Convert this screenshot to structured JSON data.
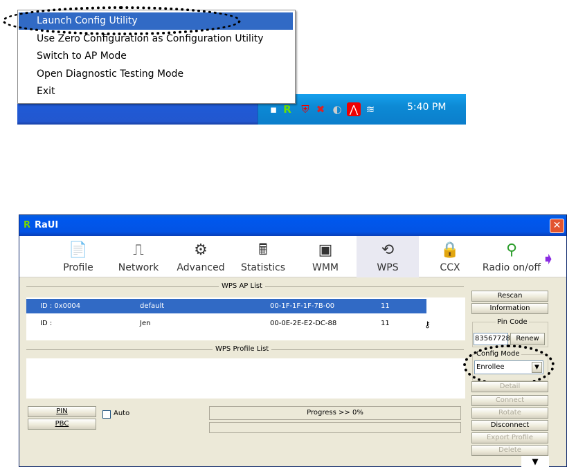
{
  "context_menu": {
    "items": [
      {
        "label": "Launch Config Utility"
      },
      {
        "label": "Use Zero Configuration as Configuration Utility"
      },
      {
        "label": "Switch to AP Mode"
      },
      {
        "label": "Open Diagnostic Testing Mode"
      },
      {
        "label": "Exit"
      }
    ]
  },
  "taskbar": {
    "clock": "5:40 PM"
  },
  "window": {
    "logo": "R",
    "title": "RaUI",
    "close_label": "✕",
    "toolbar": [
      {
        "label": "Profile",
        "icon": "📄"
      },
      {
        "label": "Network",
        "icon": "⎍"
      },
      {
        "label": "Advanced",
        "icon": "⚙"
      },
      {
        "label": "Statistics",
        "icon": "🖩"
      },
      {
        "label": "WMM",
        "icon": "▣"
      },
      {
        "label": "WPS",
        "icon": "⟲"
      },
      {
        "label": "CCX",
        "icon": "🔒"
      },
      {
        "label": "Radio on/off",
        "icon": "⚲"
      }
    ],
    "wps_ap_list_title": "WPS AP List",
    "wps_ap_list": [
      {
        "id": "ID : 0x0004",
        "ssid": "default",
        "bssid": "00-1F-1F-1F-7B-00",
        "channel": "11"
      },
      {
        "id": "ID :",
        "ssid": "Jen",
        "bssid": "00-0E-2E-E2-DC-88",
        "channel": "11"
      }
    ],
    "wps_profile_list_title": "WPS Profile List",
    "buttons": {
      "rescan": "Rescan",
      "information": "Information",
      "pin_code_label": "Pin Code",
      "pin_code_value": "83567728",
      "renew": "Renew",
      "config_mode_label": "Config Mode",
      "config_mode_value": "Enrollee",
      "detail": "Detail",
      "connect": "Connect",
      "rotate": "Rotate",
      "disconnect": "Disconnect",
      "export_profile": "Export Profile",
      "delete": "Delete",
      "pin": "PIN",
      "pbc": "PBC",
      "auto": "Auto"
    },
    "progress_text": "Progress >> 0%"
  }
}
